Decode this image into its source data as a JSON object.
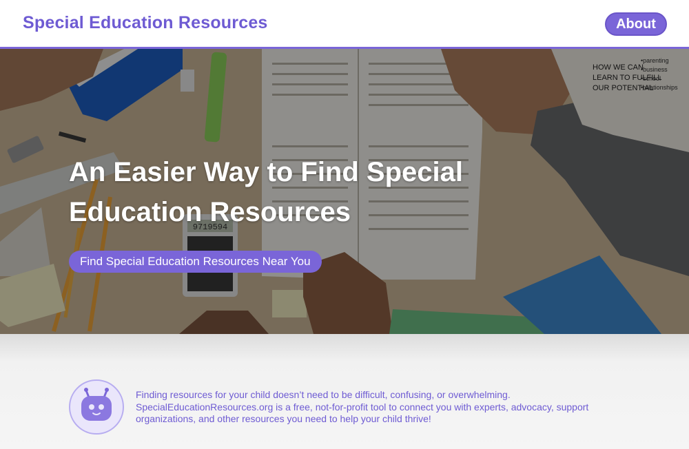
{
  "header": {
    "brand": "Special Education Resources",
    "about_label": "About"
  },
  "hero": {
    "headline_line1": "An Easier Way to Find Special",
    "headline_line2": "Education Resources",
    "cta_label": "Find Special Education Resources Near You",
    "photo_book_text": [
      "HOW WE CAN",
      "LEARN TO FULFILL",
      "OUR POTENTIAL"
    ],
    "photo_list_text": [
      "•parenting",
      "•business",
      "•school",
      "•relationships"
    ],
    "calculator_display": "9719594"
  },
  "intro": {
    "line1": "Finding resources for your child doesn’t need to be difficult, confusing, or overwhelming.",
    "line2": "SpecialEducationResources.org is a free, not-for-profit tool to connect you with experts, advocacy, support",
    "line3": "organizations, and other resources you need to help your child thrive!"
  },
  "colors": {
    "brand_purple": "#6e5bd3",
    "button_purple": "#7a65d8",
    "header_bg": "#ffffff",
    "band_bg": "#f3f3f3"
  },
  "icons": {
    "avatar": "robot-icon"
  }
}
